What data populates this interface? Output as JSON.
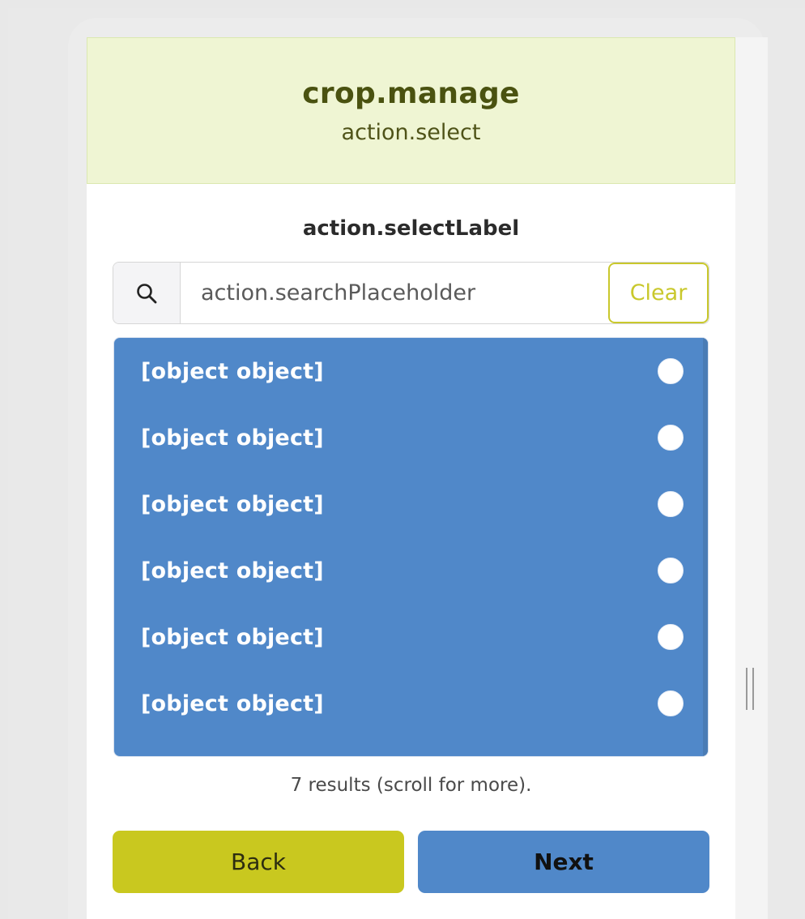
{
  "header": {
    "title": "crop.manage",
    "subtitle": "action.select"
  },
  "form": {
    "select_label": "action.selectLabel",
    "search": {
      "placeholder": "action.searchPlaceholder",
      "value": "",
      "icon": "search-icon",
      "clear_label": "Clear"
    }
  },
  "results": {
    "items": [
      {
        "label": "[object object]",
        "selected": false
      },
      {
        "label": "[object object]",
        "selected": false
      },
      {
        "label": "[object object]",
        "selected": false
      },
      {
        "label": "[object object]",
        "selected": false
      },
      {
        "label": "[object object]",
        "selected": false
      },
      {
        "label": "[object object]",
        "selected": false
      }
    ],
    "count_text": "7 results (scroll for more)."
  },
  "footer": {
    "back_label": "Back",
    "next_label": "Next"
  },
  "colors": {
    "header_bg": "#eff5d3",
    "accent_yellow": "#c9c81f",
    "accent_blue": "#5088c9"
  }
}
